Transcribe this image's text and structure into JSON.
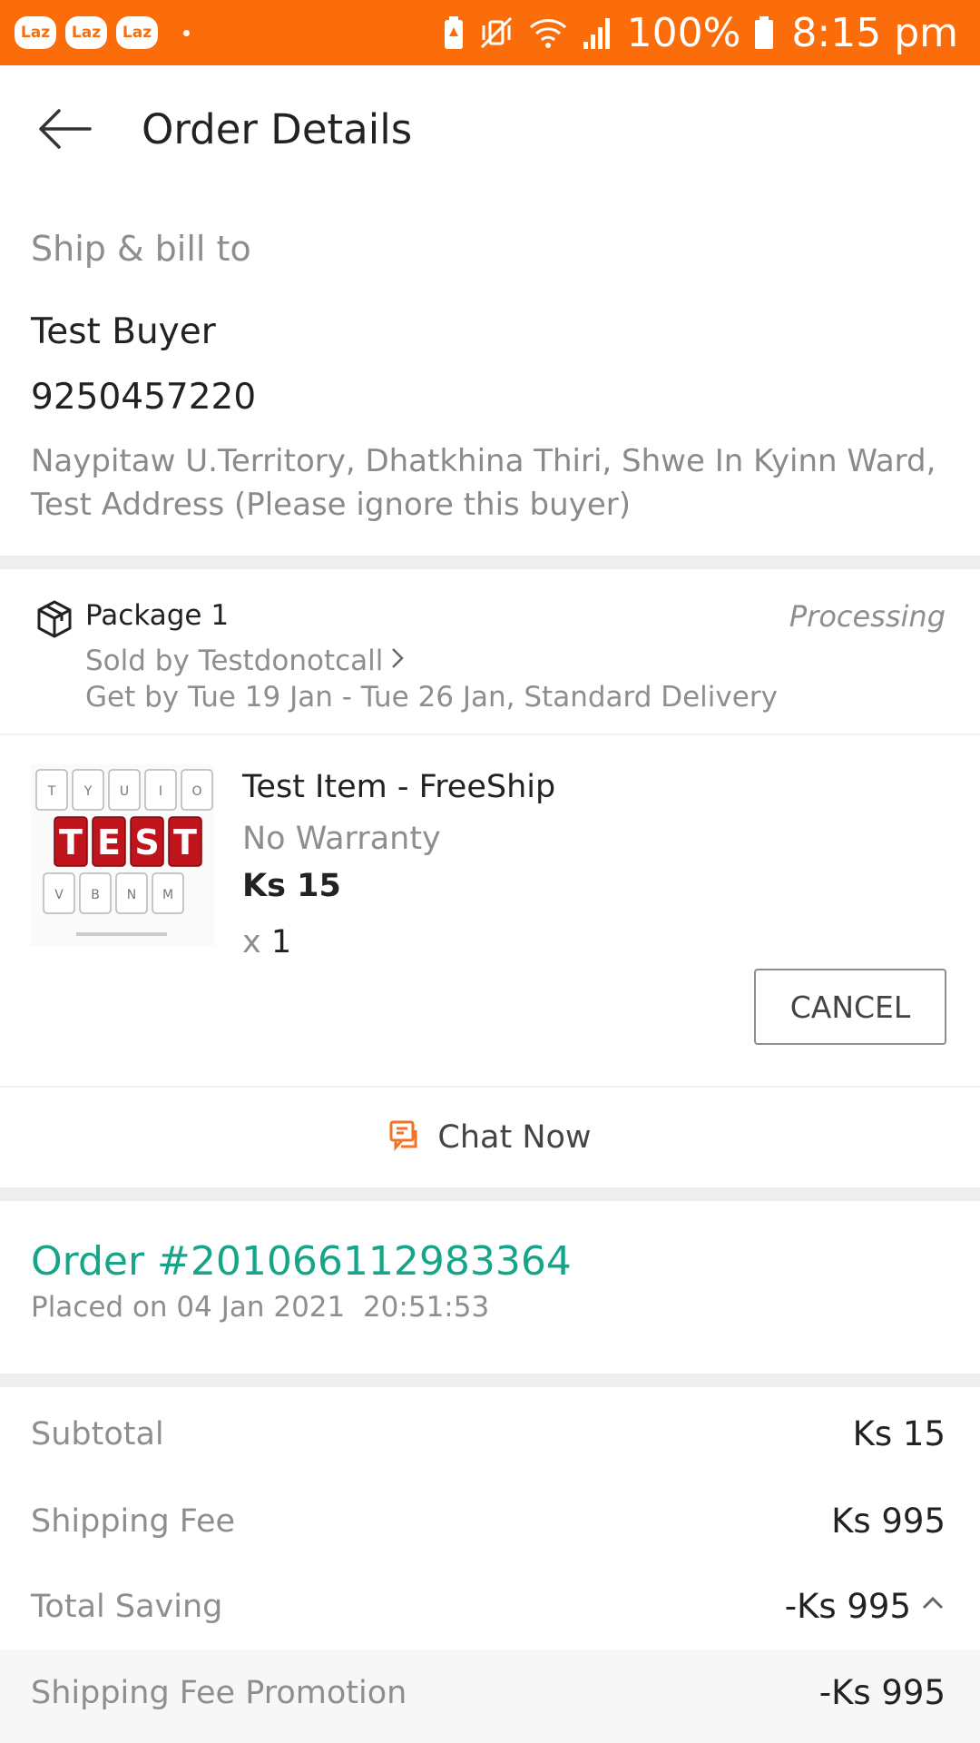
{
  "status_bar": {
    "apps": [
      "Laz",
      "Laz",
      "Laz"
    ],
    "battery": "100%",
    "time": "8:15 pm",
    "icons": [
      "battery-saver-icon",
      "vibrate-icon",
      "wifi-icon",
      "signal-icon",
      "battery-icon"
    ]
  },
  "header": {
    "title": "Order Details",
    "back_icon": "back-arrow-icon"
  },
  "shipping": {
    "section_label": "Ship & bill to",
    "name": "Test Buyer",
    "phone": "9250457220",
    "address": "Naypitaw U.Territory, Dhatkhina Thiri, Shwe In Kyinn Ward, Test Address (Please ignore this buyer)"
  },
  "package": {
    "title": "Package 1",
    "status": "Processing",
    "seller": "Sold by Testdonotcall",
    "delivery": "Get by Tue 19 Jan - Tue 26 Jan, Standard Delivery",
    "icon": "package-icon"
  },
  "item": {
    "name": "Test Item - FreeShip",
    "warranty": "No Warranty",
    "price": "Ks 15",
    "qty_prefix": "x",
    "qty": "1",
    "image_keys_top": [
      "T",
      "Y",
      "U",
      "I",
      "O"
    ],
    "image_keys_mid": [
      "T",
      "E",
      "S",
      "T"
    ],
    "image_keys_bottom": [
      "V",
      "B",
      "N",
      "M"
    ],
    "cancel_label": "CANCEL"
  },
  "chat": {
    "label": "Chat Now",
    "icon": "chat-icon"
  },
  "order": {
    "number": "Order #201066112983364",
    "placed": "Placed on 04 Jan 2021  20:51:53"
  },
  "summary": {
    "rows": [
      {
        "label": "Subtotal",
        "value": "Ks 15"
      },
      {
        "label": "Shipping Fee",
        "value": "Ks 995"
      },
      {
        "label": "Total Saving",
        "value": "-Ks 995"
      },
      {
        "label": "Shipping Fee Promotion",
        "value": "-Ks 995"
      }
    ]
  },
  "colors": {
    "brand_orange": "#fb6d0b",
    "order_green": "#17a589",
    "key_red": "#c0141c"
  }
}
